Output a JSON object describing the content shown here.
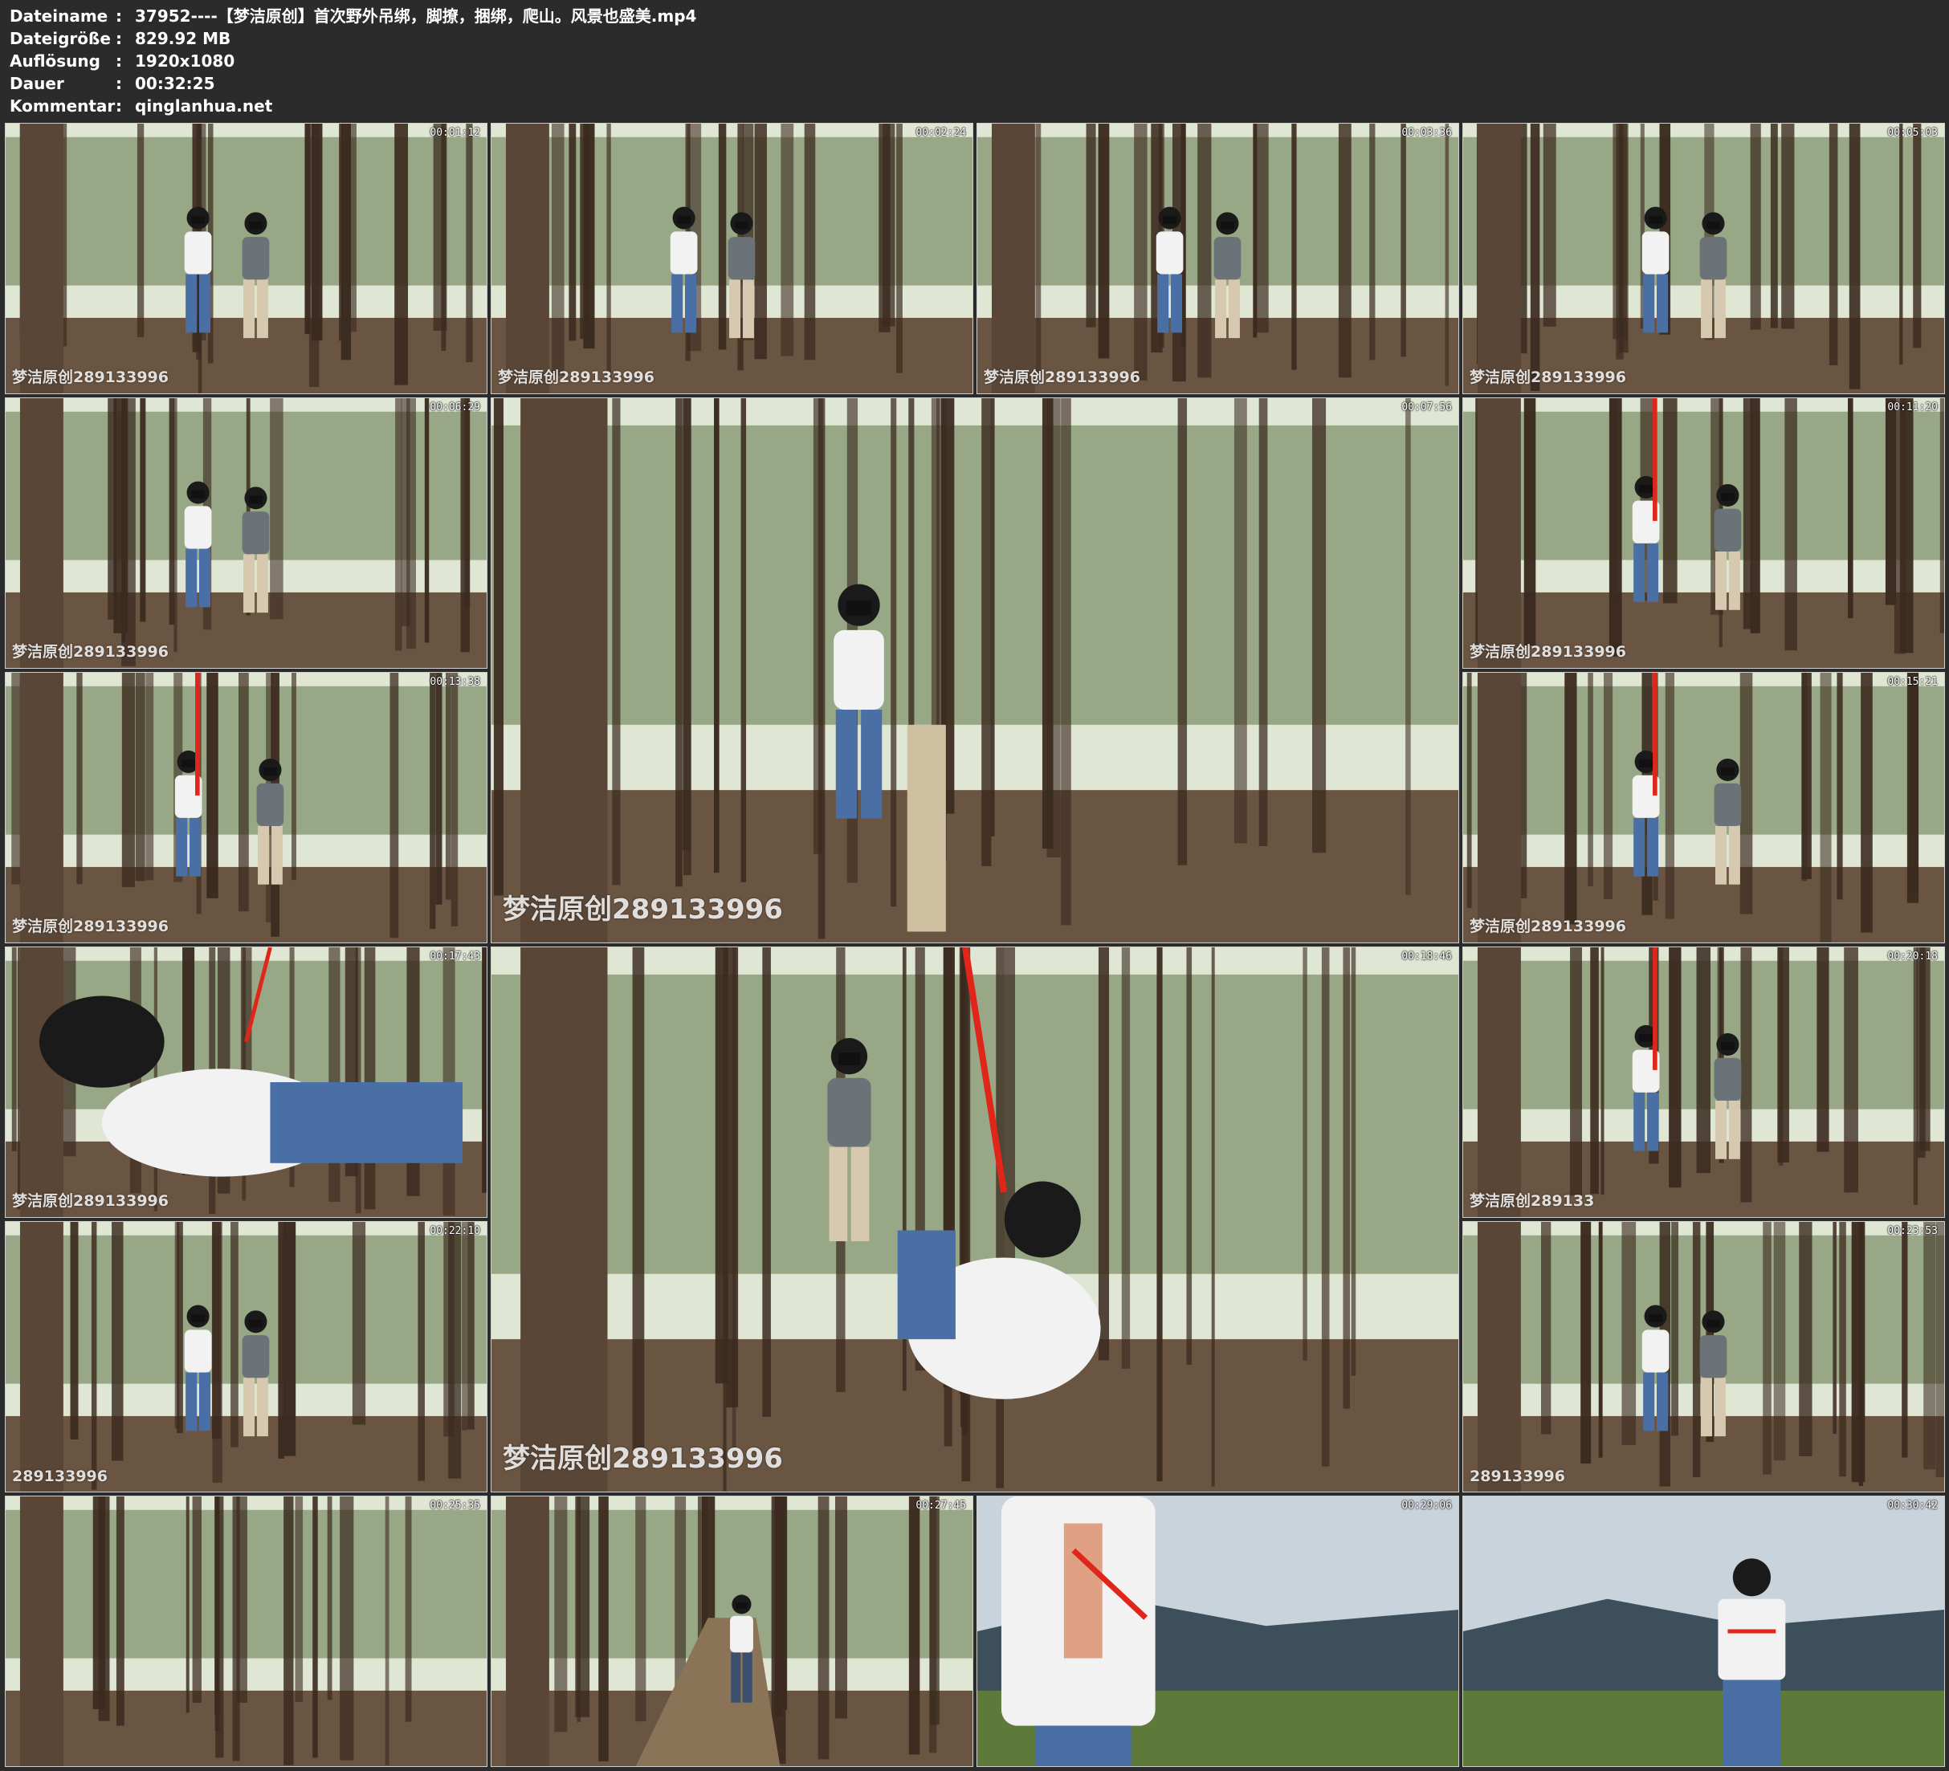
{
  "header": {
    "rows": [
      {
        "label": "Dateiname",
        "value": "37952----【梦洁原创】首次野外吊绑，脚撩，捆绑，爬山。风景也盛美.mp4"
      },
      {
        "label": "Dateigröße",
        "value": "829.92 MB"
      },
      {
        "label": "Auflösung",
        "value": "1920x1080"
      },
      {
        "label": "Dauer",
        "value": "00:32:25"
      },
      {
        "label": "Kommentar",
        "value": "qinglanhua.net"
      }
    ],
    "separator": ":"
  },
  "thumbnails": [
    {
      "timestamp": "00:01:12",
      "watermark": "梦洁原创289133996"
    },
    {
      "timestamp": "00:02:24",
      "watermark": "梦洁原创289133996"
    },
    {
      "timestamp": "00:03:36",
      "watermark": "梦洁原创289133996"
    },
    {
      "timestamp": "00:05:03",
      "watermark": "梦洁原创289133996"
    },
    {
      "timestamp": "00:06:29",
      "watermark": "梦洁原创289133996"
    },
    {
      "timestamp": "00:07:56",
      "watermark": "梦洁原创289133996"
    },
    {
      "timestamp": "00:11:20",
      "watermark": "梦洁原创289133996"
    },
    {
      "timestamp": "00:13:38",
      "watermark": "梦洁原创289133996"
    },
    {
      "timestamp": "00:15:21",
      "watermark": "梦洁原创289133996"
    },
    {
      "timestamp": "00:17:43",
      "watermark": "梦洁原创289133996"
    },
    {
      "timestamp": "00:18:46",
      "watermark": "梦洁原创289133996"
    },
    {
      "timestamp": "00:20:18",
      "watermark": "梦洁原创289133"
    },
    {
      "timestamp": "00:22:10",
      "watermark": "289133996"
    },
    {
      "timestamp": "00:23:53",
      "watermark": "289133996"
    },
    {
      "timestamp": "00:25:35",
      "watermark": ""
    },
    {
      "timestamp": "00:27:45",
      "watermark": ""
    },
    {
      "timestamp": "00:29:06",
      "watermark": ""
    },
    {
      "timestamp": "00:30:42",
      "watermark": ""
    }
  ],
  "scene_colors": {
    "forest_sky": "#dfe6d4",
    "forest_foliage": "#5d7343",
    "forest_ground": "#6a5442",
    "trunk": "#3b2a1f",
    "mountain_sky": "#c9d3dc",
    "mountain": "#3d4f5a",
    "grass": "#5e7a3a",
    "shirt": "#f2f2f2",
    "jeans": "#4a6fa5",
    "rope_red": "#e0261b"
  }
}
